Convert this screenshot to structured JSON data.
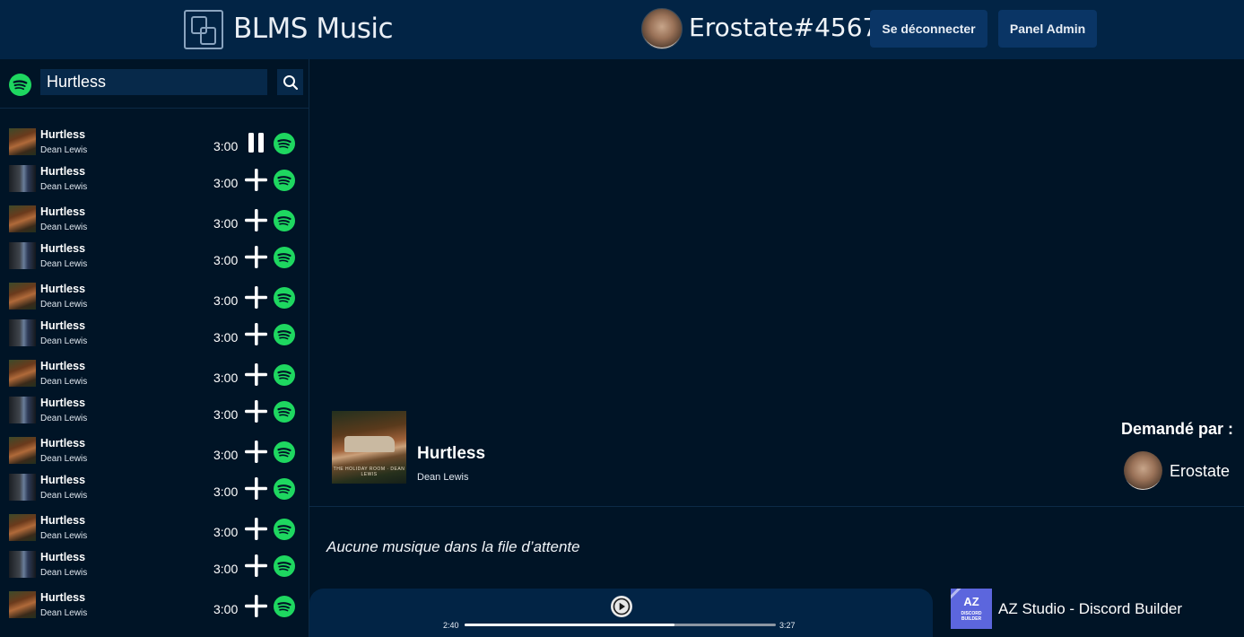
{
  "header": {
    "brand": "BLMS Music",
    "username": "Erostate#4567",
    "logout_label": "Se déconnecter",
    "admin_label": "Panel Admin"
  },
  "search": {
    "value": "Hurtless"
  },
  "results": [
    {
      "title": "Hurtless",
      "artist": "Dean Lewis",
      "duration": "3:00",
      "action": "pause",
      "cover": "a"
    },
    {
      "title": "Hurtless",
      "artist": "Dean Lewis",
      "duration": "3:00",
      "action": "add",
      "cover": "b"
    },
    {
      "title": "Hurtless",
      "artist": "Dean Lewis",
      "duration": "3:00",
      "action": "add",
      "cover": "a"
    },
    {
      "title": "Hurtless",
      "artist": "Dean Lewis",
      "duration": "3:00",
      "action": "add",
      "cover": "b"
    },
    {
      "title": "Hurtless",
      "artist": "Dean Lewis",
      "duration": "3:00",
      "action": "add",
      "cover": "a"
    },
    {
      "title": "Hurtless",
      "artist": "Dean Lewis",
      "duration": "3:00",
      "action": "add",
      "cover": "b"
    },
    {
      "title": "Hurtless",
      "artist": "Dean Lewis",
      "duration": "3:00",
      "action": "add",
      "cover": "a"
    },
    {
      "title": "Hurtless",
      "artist": "Dean Lewis",
      "duration": "3:00",
      "action": "add",
      "cover": "b"
    },
    {
      "title": "Hurtless",
      "artist": "Dean Lewis",
      "duration": "3:00",
      "action": "add",
      "cover": "a"
    },
    {
      "title": "Hurtless",
      "artist": "Dean Lewis",
      "duration": "3:00",
      "action": "add",
      "cover": "b"
    },
    {
      "title": "Hurtless",
      "artist": "Dean Lewis",
      "duration": "3:00",
      "action": "add",
      "cover": "a"
    },
    {
      "title": "Hurtless",
      "artist": "Dean Lewis",
      "duration": "3:00",
      "action": "add",
      "cover": "b"
    },
    {
      "title": "Hurtless",
      "artist": "Dean Lewis",
      "duration": "3:00",
      "action": "add",
      "cover": "a"
    }
  ],
  "now_playing": {
    "title": "Hurtless",
    "artist": "Dean Lewis",
    "cover_caption": "THE HOLIDAY ROOM · DEAN LEWIS",
    "requested_by_label": "Demandé par :",
    "requester": "Erostate"
  },
  "queue": {
    "empty_text": "Aucune musique dans la file d’attente"
  },
  "player": {
    "current_time": "2:40",
    "total_time": "3:27",
    "progress_fraction": 0.675
  },
  "footer": {
    "logo_big": "AZ",
    "logo_small": "DISCORD BUILDER",
    "name": "AZ Studio - Discord Builder"
  },
  "colors": {
    "header_bg": "#022445",
    "page_bg": "#001426",
    "spotify_green": "#1ed760",
    "button_bg": "#0a3565",
    "az_purple": "#5c66dd"
  },
  "icons": {
    "spotify": "spotify-icon",
    "search": "search-icon",
    "pause": "pause-icon",
    "add": "plus-icon",
    "play": "play-icon"
  }
}
